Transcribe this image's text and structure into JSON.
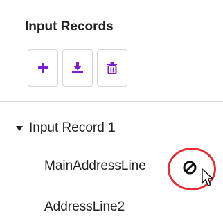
{
  "panel": {
    "title": "Input Records"
  },
  "toolbar": {
    "buttons": [
      {
        "icon": "plus-icon"
      },
      {
        "icon": "download-icon"
      },
      {
        "icon": "trash-icon"
      }
    ],
    "accent_color": "#7b1fd0"
  },
  "tree": {
    "node": {
      "label": "Input Record 1",
      "expanded": true
    },
    "leaves": [
      {
        "label": "MainAddressLine"
      },
      {
        "label": "AddressLine2"
      }
    ]
  },
  "drag_feedback": {
    "icon": "no-drop-icon",
    "ring_color": "#e0303a",
    "cursor": "arrow-cursor-icon"
  }
}
